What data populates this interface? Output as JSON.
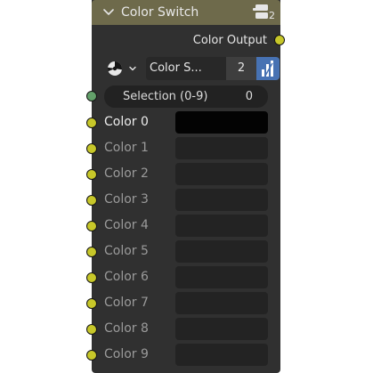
{
  "node": {
    "title": "Color Switch",
    "group_count": "2",
    "header_color": "#6e6a4b",
    "body_color": "#303030"
  },
  "output": {
    "label": "Color Output",
    "socket_color": "#c7c729"
  },
  "properties": {
    "color_mode_icon": "color-wheel-icon",
    "type_label": "Color S...",
    "count": "2",
    "sort_icon": "bar-graph-icon",
    "accent_color": "#4772b3"
  },
  "selection": {
    "label": "Selection (0-9)",
    "value": "0",
    "socket_color": "#63a06a"
  },
  "inputs": [
    {
      "label": "Color 0",
      "active": true
    },
    {
      "label": "Color 1",
      "active": false
    },
    {
      "label": "Color 2",
      "active": false
    },
    {
      "label": "Color 3",
      "active": false
    },
    {
      "label": "Color 4",
      "active": false
    },
    {
      "label": "Color 5",
      "active": false
    },
    {
      "label": "Color 6",
      "active": false
    },
    {
      "label": "Color 7",
      "active": false
    },
    {
      "label": "Color 8",
      "active": false
    },
    {
      "label": "Color 9",
      "active": false
    }
  ]
}
